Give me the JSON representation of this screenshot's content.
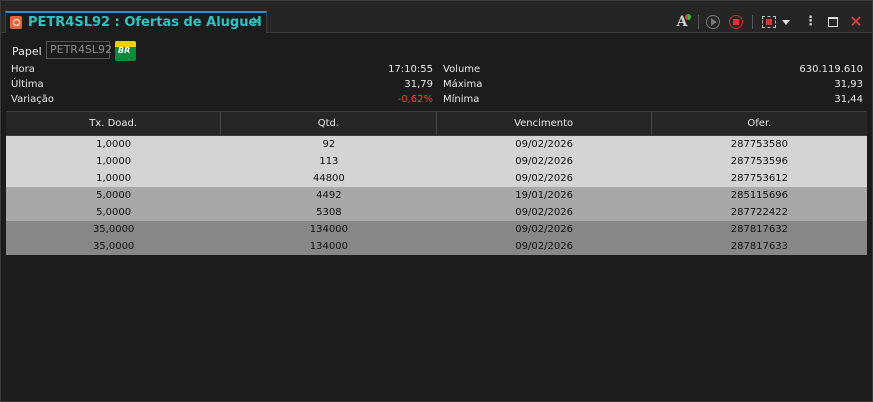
{
  "window": {
    "tab_title": "PETR4SL92 : Ofertas de Aluguel",
    "tab_close": "×",
    "font_button": "A",
    "more_button": "⋮",
    "close_button": "✕"
  },
  "info": {
    "papel_label": "Papel",
    "papel_value": "PETR4SL92",
    "logo_text": "BR",
    "left": [
      {
        "label": "Hora",
        "value": "17:10:55"
      },
      {
        "label": "Última",
        "value": "31,79"
      },
      {
        "label": "Variação",
        "value": "-0,62%"
      }
    ],
    "right": [
      {
        "label": "Volume",
        "value": "630.119.610"
      },
      {
        "label": "Máxima",
        "value": "31,93"
      },
      {
        "label": "Mínima",
        "value": "31,44"
      }
    ]
  },
  "colors": {
    "accent": "#2ec4c4",
    "negative": "#ff3b3b",
    "group1": "#d4d4d4",
    "group2": "#a8a8a8",
    "group3": "#878787"
  },
  "table": {
    "headers": [
      "Tx. Doad.",
      "Qtd.",
      "Vencimento",
      "Ofer."
    ],
    "rows": [
      [
        "1,0000",
        "92",
        "09/02/2026",
        "287753580"
      ],
      [
        "1,0000",
        "113",
        "09/02/2026",
        "287753596"
      ],
      [
        "1,0000",
        "44800",
        "09/02/2026",
        "287753612"
      ],
      [
        "5,0000",
        "4492",
        "19/01/2026",
        "285115696"
      ],
      [
        "5,0000",
        "5308",
        "09/02/2026",
        "287722422"
      ],
      [
        "35,0000",
        "134000",
        "09/02/2026",
        "287817632"
      ],
      [
        "35,0000",
        "134000",
        "09/02/2026",
        "287817633"
      ]
    ]
  }
}
